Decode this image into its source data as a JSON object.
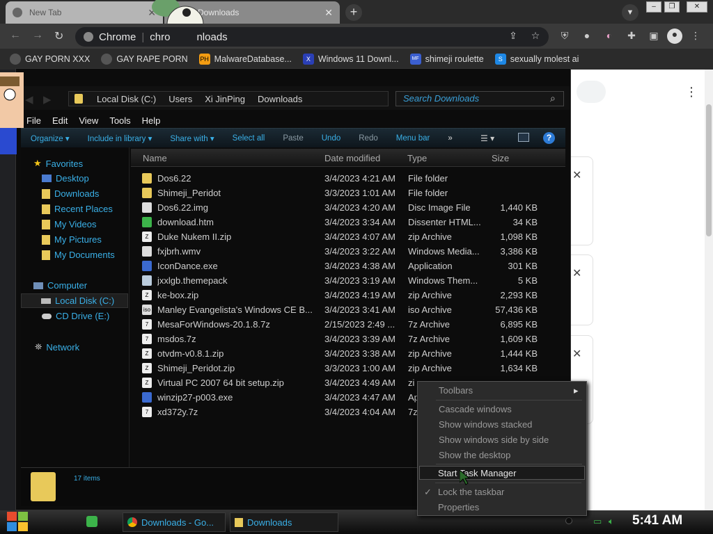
{
  "browser": {
    "tabs": [
      {
        "label": "New Tab"
      },
      {
        "label": "Downloads"
      }
    ],
    "new_tab_symbol": "+",
    "address": {
      "site": "Chrome",
      "path_prefix": "chro",
      "path_suffix": "nloads"
    },
    "bookmarks": [
      {
        "label": "GAY PORN XXX",
        "icon": "globe-icon"
      },
      {
        "label": "GAY RAPE PORN",
        "icon": "globe-icon"
      },
      {
        "label": "MalwareDatabase...",
        "icon": "ph-icon",
        "icon_text": "PH"
      },
      {
        "label": "Windows 11 Downl...",
        "icon": "x-icon",
        "icon_text": "X"
      },
      {
        "label": "shimeji roulette",
        "icon": "mf-icon",
        "icon_text": "MF"
      },
      {
        "label": "sexually molest ai",
        "icon": "bookmark-icon",
        "icon_text": "S"
      }
    ]
  },
  "explorer": {
    "breadcrumb": [
      "Local Disk (C:)",
      "Users",
      "Xi JinPing",
      "Downloads"
    ],
    "search_placeholder": "Search Downloads",
    "menu": [
      "File",
      "Edit",
      "View",
      "Tools",
      "Help"
    ],
    "commands": [
      "Organize",
      "Include in library",
      "Share with",
      "Select all",
      "Paste",
      "Undo",
      "Redo",
      "Menu bar"
    ],
    "more_symbol": "»",
    "help_symbol": "?",
    "nav": {
      "favorites_label": "Favorites",
      "favorites": [
        "Desktop",
        "Downloads",
        "Recent Places",
        "My Videos",
        "My Pictures",
        "My Documents"
      ],
      "computer_label": "Computer",
      "computer": [
        "Local Disk (C:)",
        "CD Drive (E:)"
      ],
      "network_label": "Network"
    },
    "columns": [
      "Name",
      "Date modified",
      "Type",
      "Size"
    ],
    "files": [
      {
        "name": "Dos6.22",
        "date": "3/4/2023 4:21 AM",
        "type": "File folder",
        "size": "",
        "icon": "folder-icon"
      },
      {
        "name": "Shimeji_Peridot",
        "date": "3/3/2023 1:01 AM",
        "type": "File folder",
        "size": "",
        "icon": "folder-icon"
      },
      {
        "name": "Dos6.22.img",
        "date": "3/4/2023 4:20 AM",
        "type": "Disc Image File",
        "size": "1,440 KB",
        "icon": "disc-icon"
      },
      {
        "name": "download.htm",
        "date": "3/4/2023 3:34 AM",
        "type": "Dissenter HTML...",
        "size": "34 KB",
        "icon": "html-icon"
      },
      {
        "name": "Duke Nukem II.zip",
        "date": "3/4/2023 4:07 AM",
        "type": "zip Archive",
        "size": "1,098 KB",
        "icon": "zip-icon"
      },
      {
        "name": "fxjbrh.wmv",
        "date": "3/4/2023 3:22 AM",
        "type": "Windows Media...",
        "size": "3,386 KB",
        "icon": "video-icon"
      },
      {
        "name": "IconDance.exe",
        "date": "3/4/2023 4:38 AM",
        "type": "Application",
        "size": "301 KB",
        "icon": "exe-icon"
      },
      {
        "name": "jxxlgb.themepack",
        "date": "3/4/2023 3:19 AM",
        "type": "Windows Them...",
        "size": "5 KB",
        "icon": "theme-icon"
      },
      {
        "name": "ke-box.zip",
        "date": "3/4/2023 4:19 AM",
        "type": "zip Archive",
        "size": "2,293 KB",
        "icon": "zip-icon"
      },
      {
        "name": "Manley Evangelista's Windows CE B...",
        "date": "3/4/2023 3:41 AM",
        "type": "iso Archive",
        "size": "57,436 KB",
        "icon": "iso-icon"
      },
      {
        "name": "MesaForWindows-20.1.8.7z",
        "date": "2/15/2023 2:49 ...",
        "type": "7z Archive",
        "size": "6,895 KB",
        "icon": "7z-icon"
      },
      {
        "name": "msdos.7z",
        "date": "3/4/2023 3:39 AM",
        "type": "7z Archive",
        "size": "1,609 KB",
        "icon": "7z-icon"
      },
      {
        "name": "otvdm-v0.8.1.zip",
        "date": "3/4/2023 3:38 AM",
        "type": "zip Archive",
        "size": "1,444 KB",
        "icon": "zip-icon"
      },
      {
        "name": "Shimeji_Peridot.zip",
        "date": "3/3/2023 1:00 AM",
        "type": "zip Archive",
        "size": "1,634 KB",
        "icon": "zip-icon"
      },
      {
        "name": "Virtual PC 2007 64 bit setup.zip",
        "date": "3/4/2023 4:49 AM",
        "type": "zi",
        "size": "",
        "icon": "zip-icon"
      },
      {
        "name": "winzip27-p003.exe",
        "date": "3/4/2023 4:47 AM",
        "type": "Ap",
        "size": "",
        "icon": "exe-icon"
      },
      {
        "name": "xd372y.7z",
        "date": "3/4/2023 4:04 AM",
        "type": "7z",
        "size": "",
        "icon": "7z-icon"
      }
    ],
    "status": "17 items"
  },
  "context_menu": {
    "items": [
      "Toolbars",
      "Cascade windows",
      "Show windows stacked",
      "Show windows side by side",
      "Show the desktop",
      "Start Task Manager",
      "Lock the taskbar",
      "Properties"
    ],
    "submenu_arrow": "▸",
    "check": "✓"
  },
  "taskbar": {
    "buttons": [
      "Downloads - Go...",
      "Downloads"
    ],
    "clock": "5:41 AM"
  },
  "colors": {
    "accent": "#3ab0e8"
  }
}
